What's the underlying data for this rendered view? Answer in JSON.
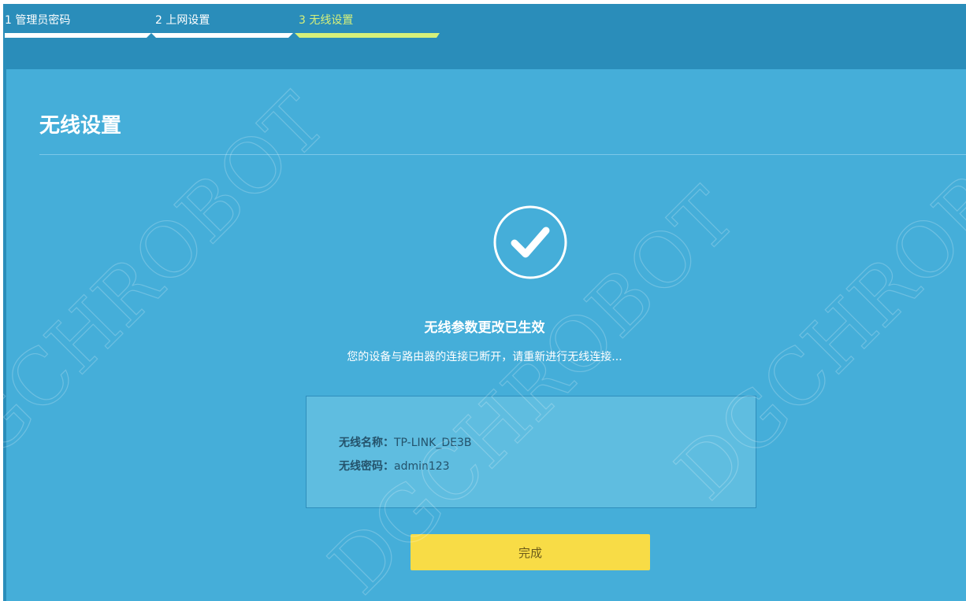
{
  "wizard": {
    "steps": [
      {
        "label": "1 管理员密码",
        "bar_color": "#ffffff",
        "label_color": "#ffffff"
      },
      {
        "label": "2 上网设置",
        "bar_color": "#ffffff",
        "label_color": "#ffffff"
      },
      {
        "label": "3 无线设置",
        "bar_color": "#d6f07a",
        "label_color": "#d6f07a"
      }
    ]
  },
  "page": {
    "title": "无线设置"
  },
  "result": {
    "icon": "checkmark-circle-icon",
    "title": "无线参数更改已生效",
    "message": "您的设备与路由器的连接已断开，请重新进行无线连接..."
  },
  "wireless_info": {
    "ssid_label": "无线名称：",
    "ssid_value": "TP-LINK_DE3B",
    "password_label": "无线密码：",
    "password_value": "admin123"
  },
  "actions": {
    "finish_label": "完成"
  },
  "colors": {
    "background": "#45aed9",
    "header": "#2a8dba",
    "active_step": "#d6f07a",
    "button": "#f8dc46"
  },
  "watermark": {
    "text": "DGCHROBOT"
  }
}
